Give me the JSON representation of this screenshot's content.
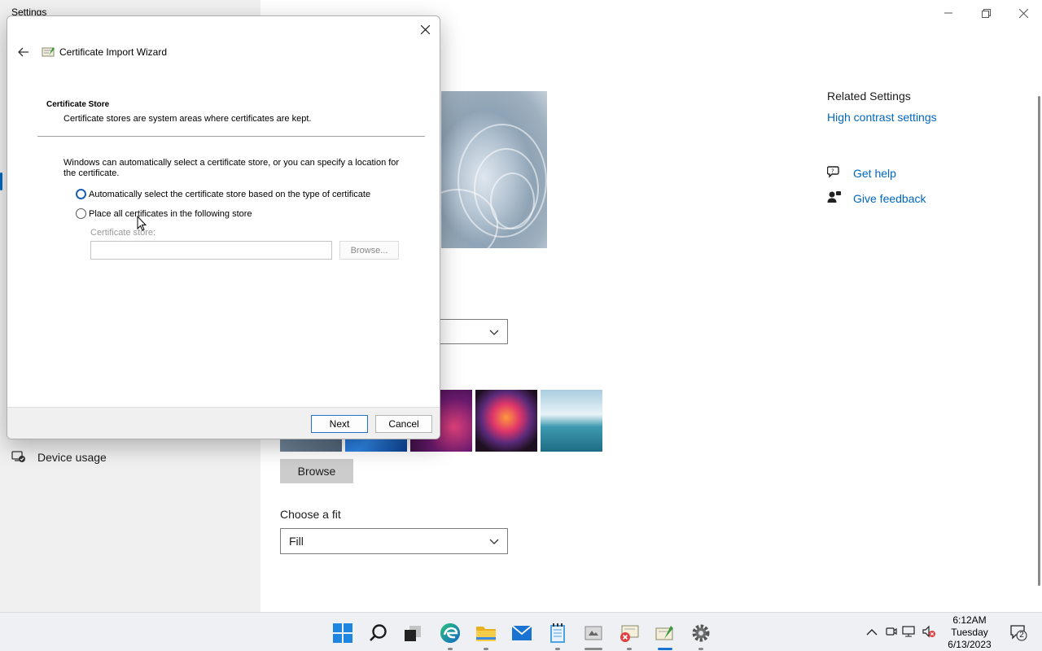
{
  "settings": {
    "title": "Settings",
    "sidebar": {
      "device_usage": "Device usage"
    },
    "background_dropdown": "",
    "browse_label": "Browse",
    "choose_fit_label": "Choose a fit",
    "fit_value": "Fill",
    "related": {
      "title": "Related Settings",
      "high_contrast": "High contrast settings",
      "get_help": "Get help",
      "give_feedback": "Give feedback"
    }
  },
  "wizard": {
    "title": "Certificate Import Wizard",
    "section_title": "Certificate Store",
    "section_desc": "Certificate stores are system areas where certificates are kept.",
    "body_text": "Windows can automatically select a certificate store, or you can specify a location for the certificate.",
    "radio_auto": "Automatically select the certificate store based on the type of certificate",
    "radio_manual": "Place all certificates in the following store",
    "store_label": "Certificate store:",
    "store_value": "",
    "browse_label": "Browse...",
    "next_label": "Next",
    "cancel_label": "Cancel"
  },
  "taskbar": {
    "time": "6:12AM",
    "day": "Tuesday",
    "date": "6/13/2023",
    "notification_count": "2",
    "apps": [
      "start-icon",
      "search-icon",
      "task-view-icon",
      "edge-icon",
      "file-explorer-icon",
      "mail-icon",
      "notepad-icon",
      "app-icon",
      "certificate-error-icon",
      "certificate-wizard-icon",
      "settings-icon"
    ]
  },
  "colors": {
    "accent": "#0067c0",
    "primary_button_border": "#2270c8"
  }
}
